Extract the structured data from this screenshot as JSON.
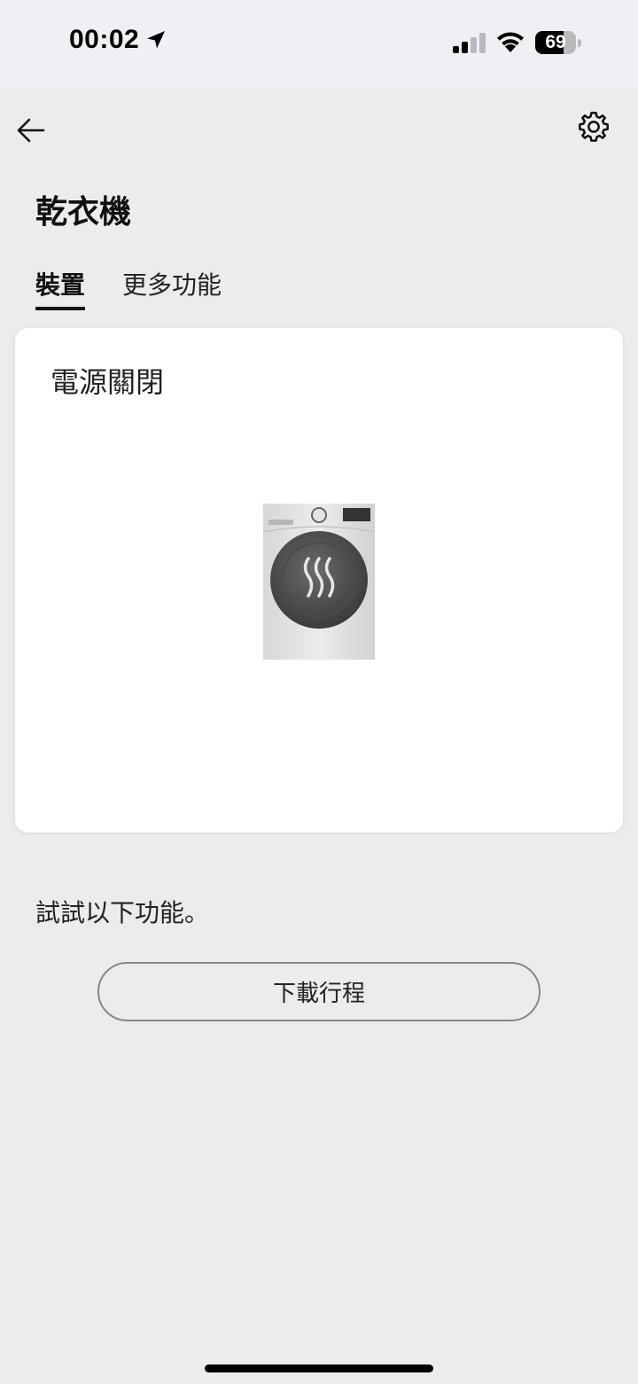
{
  "status_bar": {
    "time": "00:02",
    "battery_level": "69",
    "battery_fraction": 0.69
  },
  "header": {
    "back_icon": "arrow-left-icon",
    "settings_icon": "gear-icon"
  },
  "page": {
    "title": "乾衣機"
  },
  "tabs": [
    {
      "label": "裝置",
      "active": true
    },
    {
      "label": "更多功能",
      "active": false
    }
  ],
  "device_card": {
    "status": "電源關閉",
    "image_icon": "dryer-icon"
  },
  "hint": {
    "text": "試試以下功能。"
  },
  "actions": {
    "download_schedule_label": "下載行程"
  }
}
